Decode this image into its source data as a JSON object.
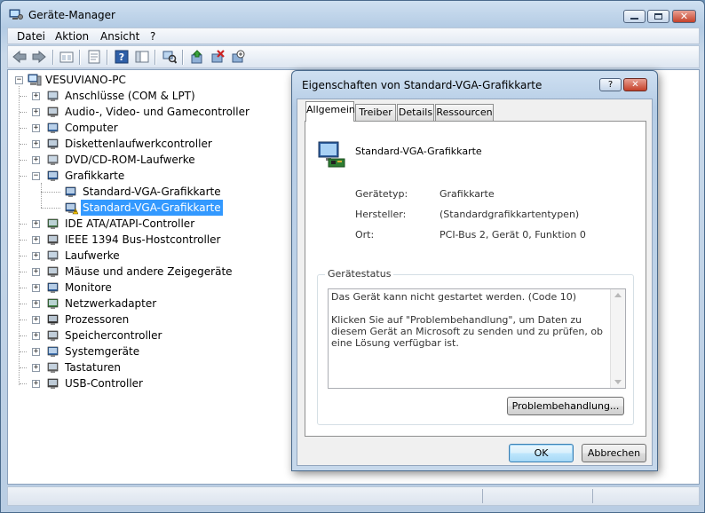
{
  "window": {
    "title": "Geräte-Manager",
    "menu": [
      "Datei",
      "Aktion",
      "Ansicht",
      "?"
    ]
  },
  "toolbar": {
    "buttons": [
      "back-icon",
      "forward-icon",
      "up-icon",
      "properties-icon",
      "help-icon",
      "show-hide-console-icon",
      "scan-hardware-icon",
      "update-driver-icon",
      "uninstall-icon",
      "disable-icon"
    ]
  },
  "tree": {
    "root": "VESUVIANO-PC",
    "items": [
      {
        "label": "Anschlüsse (COM & LPT)",
        "icon": "port-icon"
      },
      {
        "label": "Audio-, Video- und Gamecontroller",
        "icon": "speaker-icon"
      },
      {
        "label": "Computer",
        "icon": "computer-icon"
      },
      {
        "label": "Diskettenlaufwerkcontroller",
        "icon": "floppy-controller-icon"
      },
      {
        "label": "DVD/CD-ROM-Laufwerke",
        "icon": "dvd-drive-icon"
      },
      {
        "label": "Grafikkarte",
        "icon": "display-adapter-icon",
        "expanded": true
      },
      {
        "label": "IDE ATA/ATAPI-Controller",
        "icon": "ide-controller-icon"
      },
      {
        "label": "IEEE 1394 Bus-Hostcontroller",
        "icon": "firewire-icon"
      },
      {
        "label": "Laufwerke",
        "icon": "disk-drive-icon"
      },
      {
        "label": "Mäuse und andere Zeigegeräte",
        "icon": "mouse-icon"
      },
      {
        "label": "Monitore",
        "icon": "monitor-icon"
      },
      {
        "label": "Netzwerkadapter",
        "icon": "network-adapter-icon"
      },
      {
        "label": "Prozessoren",
        "icon": "processor-icon"
      },
      {
        "label": "Speichercontroller",
        "icon": "storage-controller-icon"
      },
      {
        "label": "Systemgeräte",
        "icon": "system-device-icon"
      },
      {
        "label": "Tastaturen",
        "icon": "keyboard-icon"
      },
      {
        "label": "USB-Controller",
        "icon": "usb-icon"
      }
    ],
    "grafik_children": [
      {
        "label": "Standard-VGA-Grafikkarte",
        "warning": false
      },
      {
        "label": "Standard-VGA-Grafikkarte",
        "warning": true,
        "selected": true
      }
    ]
  },
  "dialog": {
    "title": "Eigenschaften von Standard-VGA-Grafikkarte",
    "help_label": "?",
    "tabs": [
      "Allgemein",
      "Treiber",
      "Details",
      "Ressourcen"
    ],
    "active_tab": "Allgemein",
    "device_name": "Standard-VGA-Grafikkarte",
    "props": [
      {
        "label": "Gerätetyp:",
        "value": "Grafikkarte"
      },
      {
        "label": "Hersteller:",
        "value": "(Standardgrafikkartentypen)"
      },
      {
        "label": "Ort:",
        "value": "PCI-Bus 2, Gerät 0, Funktion 0"
      }
    ],
    "status_group": "Gerätestatus",
    "status_text": "Das Gerät kann nicht gestartet werden. (Code 10)\n\nKlicken Sie auf \"Problembehandlung\", um Daten zu diesem Gerät an Microsoft zu senden und zu prüfen, ob eine Lösung verfügbar ist.",
    "troubleshoot_button": "Problembehandlung...",
    "ok_button": "OK",
    "cancel_button": "Abbrechen"
  }
}
